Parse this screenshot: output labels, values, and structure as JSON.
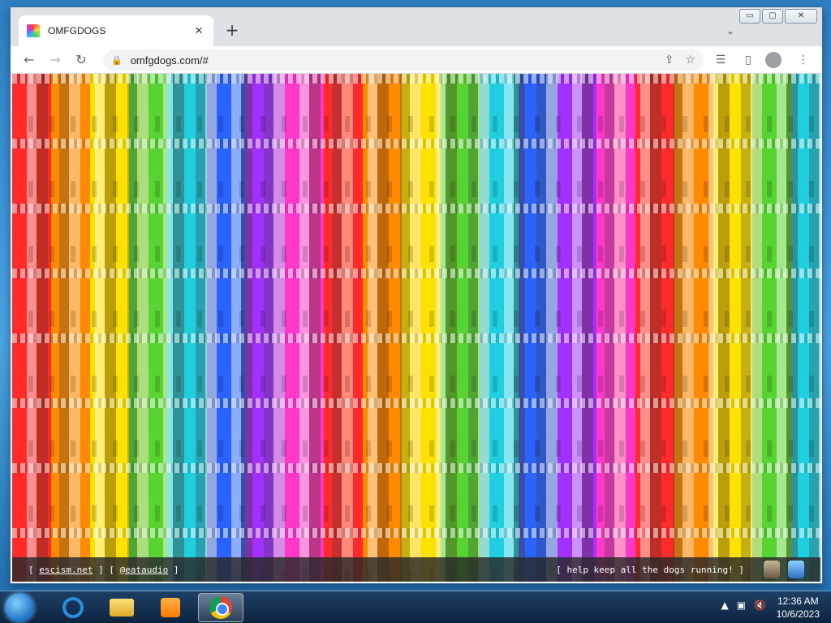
{
  "browser": {
    "tab_title": "OMFGDOGS",
    "tab_close": "✕",
    "new_tab": "+",
    "tab_search": "⌄",
    "url": "omfgdogs.com/#"
  },
  "icons": {
    "back": "←",
    "forward": "→",
    "reload": "↻",
    "lock": "🔒",
    "share": "⇪",
    "star": "☆",
    "reading_list": "☰",
    "side_panel": "▯",
    "menu": "⋮",
    "minimize": "▭",
    "maximize": "▢",
    "close": "✕"
  },
  "page": {
    "footer_left_open": "[ ",
    "link1": "escism.net",
    "footer_sep": " ] [ ",
    "link2": "@eataudio",
    "footer_left_close": " ]",
    "footer_right": "[ help keep all the dogs running! ]"
  },
  "taskbar": {
    "time": "12:36 AM",
    "date": "10/6/2023",
    "tray_up": "▲",
    "tray_net": "▣",
    "tray_vol": "🔇"
  }
}
